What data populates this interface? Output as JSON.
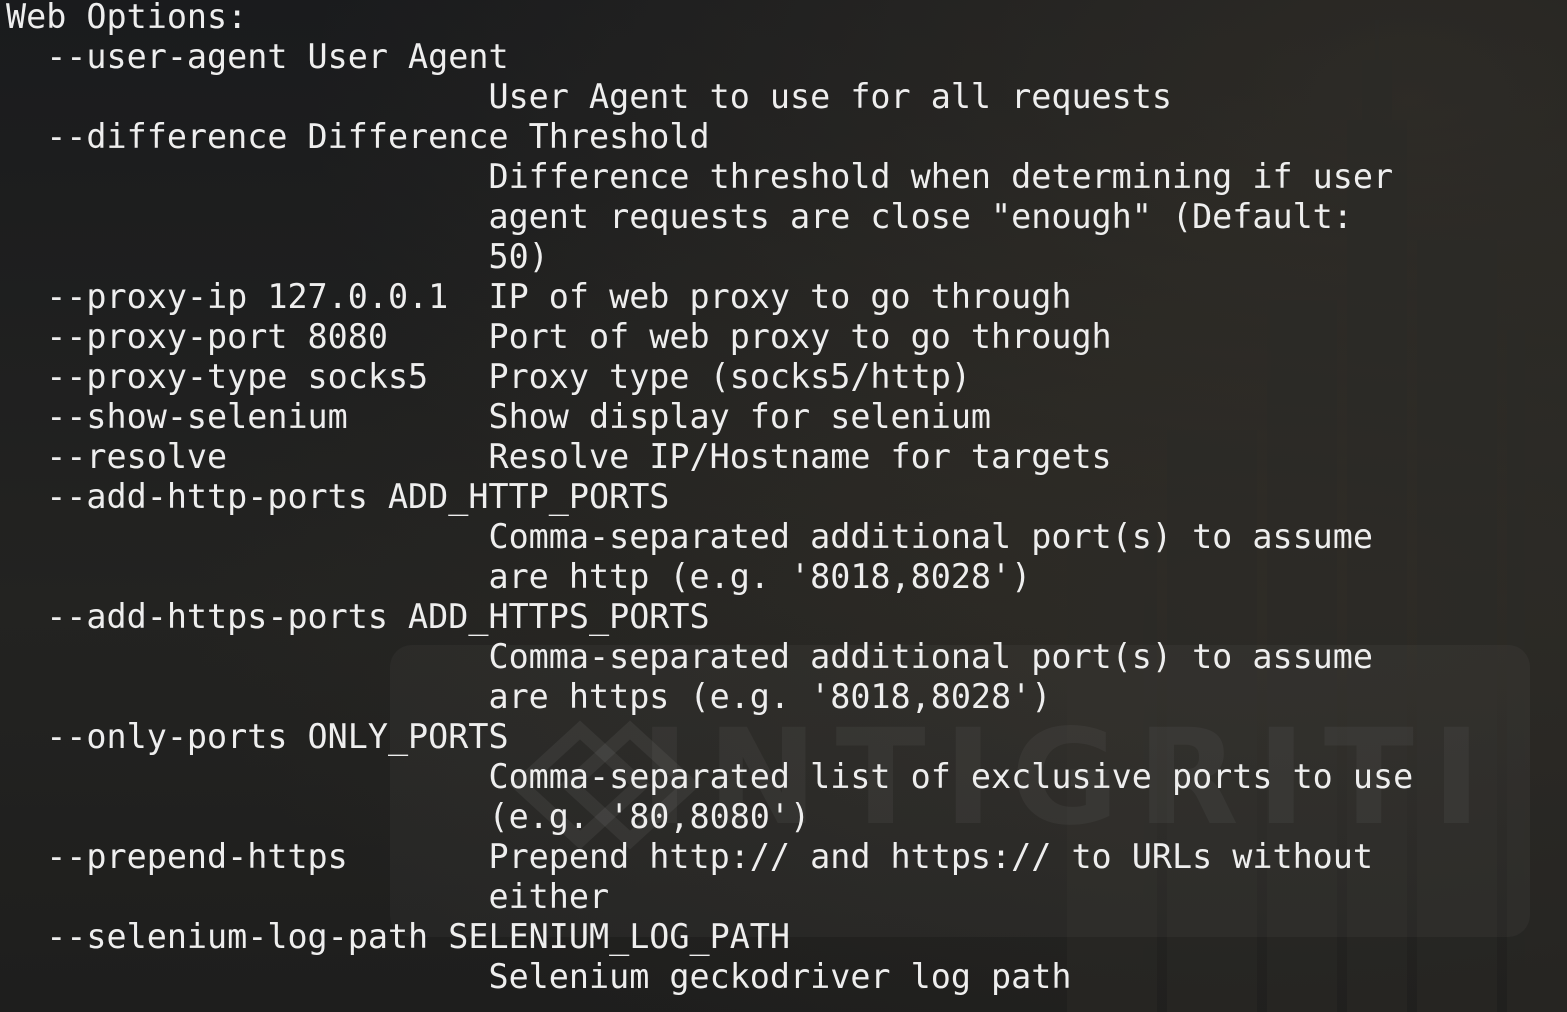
{
  "terminal": {
    "lines": [
      "Web Options:",
      "  --user-agent User Agent",
      "                        User Agent to use for all requests",
      "  --difference Difference Threshold",
      "                        Difference threshold when determining if user",
      "                        agent requests are close \"enough\" (Default:",
      "                        50)",
      "  --proxy-ip 127.0.0.1  IP of web proxy to go through",
      "  --proxy-port 8080     Port of web proxy to go through",
      "  --proxy-type socks5   Proxy type (socks5/http)",
      "  --show-selenium       Show display for selenium",
      "  --resolve             Resolve IP/Hostname for targets",
      "  --add-http-ports ADD_HTTP_PORTS",
      "                        Comma-separated additional port(s) to assume",
      "                        are http (e.g. '8018,8028')",
      "  --add-https-ports ADD_HTTPS_PORTS",
      "                        Comma-separated additional port(s) to assume",
      "                        are https (e.g. '8018,8028')",
      "  --only-ports ONLY_PORTS",
      "                        Comma-separated list of exclusive ports to use",
      "                        (e.g. '80,8080')",
      "  --prepend-https       Prepend http:// and https:// to URLs without",
      "                        either",
      "  --selenium-log-path SELENIUM_LOG_PATH",
      "                        Selenium geckodriver log path"
    ]
  },
  "watermark": {
    "brand": "INTIGRITI"
  },
  "colors": {
    "background": "#1c1d1f",
    "text": "#eeeeee"
  }
}
